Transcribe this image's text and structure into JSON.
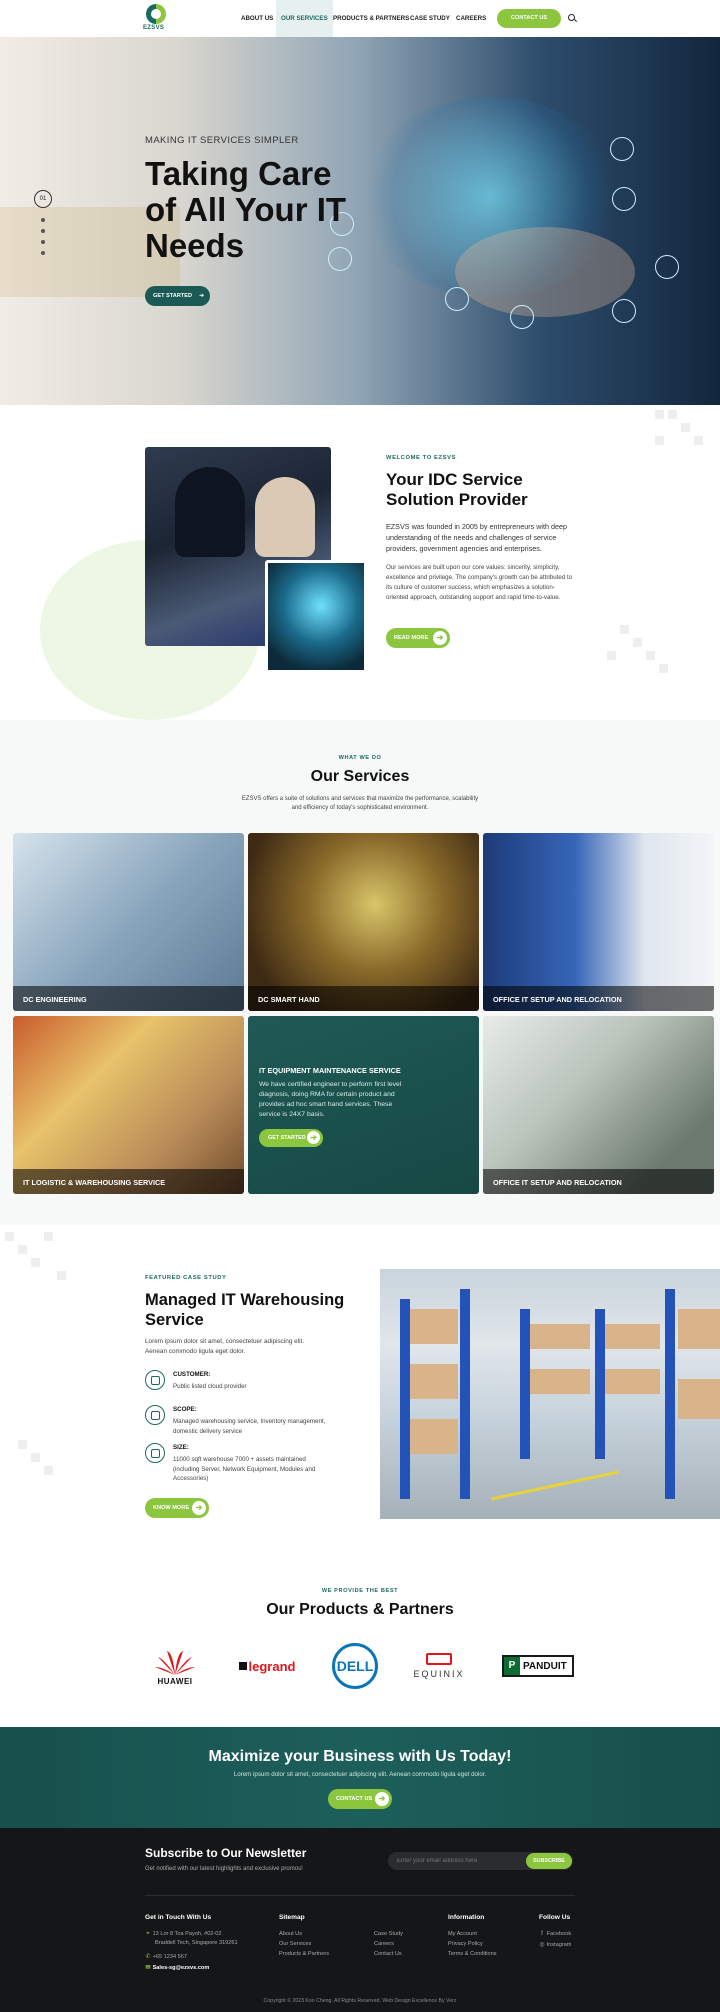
{
  "header": {
    "logo_text": "EZSVS",
    "nav": [
      "ABOUT US",
      "OUR SERVICES",
      "PRODUCTS & PARTNERS",
      "CASE STUDY",
      "CAREERS"
    ],
    "contact_label": "CONTACT US"
  },
  "hero": {
    "eyebrow": "MAKING IT SERVICES SIMPLER",
    "title": "Taking Care of All Your IT Needs",
    "button": "GET STARTED",
    "slide_number": "01"
  },
  "about": {
    "eyebrow": "WELCOME TO EZSVS",
    "title": "Your IDC Service Solution Provider",
    "p1": "EZSVS was founded in 2005 by entrepreneurs with deep understanding of the needs and challenges of service providers, government agencies and enterprises.",
    "p2": "Our services are built upon our core values: sincerity, simplicity, excellence and privilege. The company's growth can be attributed to its culture of customer success, which emphasizes a solution-oriented approach, outstanding support and rapid time-to-value.",
    "button": "READ MORE"
  },
  "services": {
    "eyebrow": "WHAT WE DO",
    "title": "Our Services",
    "desc": "EZSVS offers a suite of solutions and services that maximize the performance, scalability and efficiency of today's sophisticated environment.",
    "cards": [
      "DC ENGINEERING",
      "DC SMART HAND",
      "OFFICE IT SETUP AND RELOCATION",
      "IT LOGISTIC & WAREHOUSING SERVICE",
      "IT EQUIPMENT MAINTENANCE SERVICE",
      "OFFICE IT SETUP AND RELOCATION"
    ],
    "highlight_desc": "We have certified engineer to perform first level diagnosis, doing RMA for certain product and provides ad hoc smart hand services. These service is 24X7 basis.",
    "highlight_button": "GET STARTED"
  },
  "featured": {
    "eyebrow": "FEATURED CASE STUDY",
    "title": "Managed IT Warehousing Service",
    "desc": "Lorem ipsum dolor sit amet, consectetuer adipiscing elit. Aenean commodo ligula eget dolor.",
    "items": [
      {
        "heading": "CUSTOMER:",
        "value": "Public listed cloud provider"
      },
      {
        "heading": "SCOPE:",
        "value": "Managed warehousing service, Inventory management, domestic delivery service"
      },
      {
        "heading": "SIZE:",
        "value": "11000 sqft warehouse 7000 + assets maintained (including Server, Network Equipment, Modules and Accessories)"
      }
    ],
    "button": "KNOW MORE"
  },
  "partners": {
    "eyebrow": "WE PROVIDE THE BEST",
    "title": "Our Products & Partners",
    "logos": [
      "HUAWEI",
      "legrand",
      "DELL",
      "EQUINIX",
      "PANDUIT"
    ]
  },
  "cta": {
    "title": "Maximize your Business with Us Today!",
    "desc": "Lorem ipsum dolor sit amet, consectetuer adipiscing elit. Aenean commodo ligula eget dolor.",
    "button": "CONTACT US"
  },
  "footer": {
    "newsletter_title": "Subscribe to Our Newsletter",
    "newsletter_desc": "Get notified with our latest highlights and exclusive promos!",
    "email_placeholder": "Enter your email address here",
    "subscribe": "SUBSCRIBE",
    "contact_heading": "Get in Touch With Us",
    "address1": "13 Lor 8 Toa Payoh, #02-02",
    "address2": "Braddell Tech, Singapore 319261",
    "phone": "+65 1234 567",
    "email": "Sales-sg@ezsvs.com",
    "sitemap_heading": "Sitemap",
    "sitemap": [
      "About Us",
      "Our Services",
      "Products & Partners",
      "Case Study",
      "Careers",
      "Contact Us"
    ],
    "info_heading": "Information",
    "info": [
      "My Account",
      "Privacy Policy",
      "Terms & Conditions"
    ],
    "follow_heading": "Follow Us",
    "follow": [
      "Facebook",
      "Instagram"
    ],
    "copyright": "Copyright © 2023 Koo Cheng. All Rights Reserved. Web Design Excellence By Verz"
  },
  "colors": {
    "brand_green": "#8cc63f",
    "brand_teal": "#1a6b5f",
    "footer_bg": "#151617"
  }
}
